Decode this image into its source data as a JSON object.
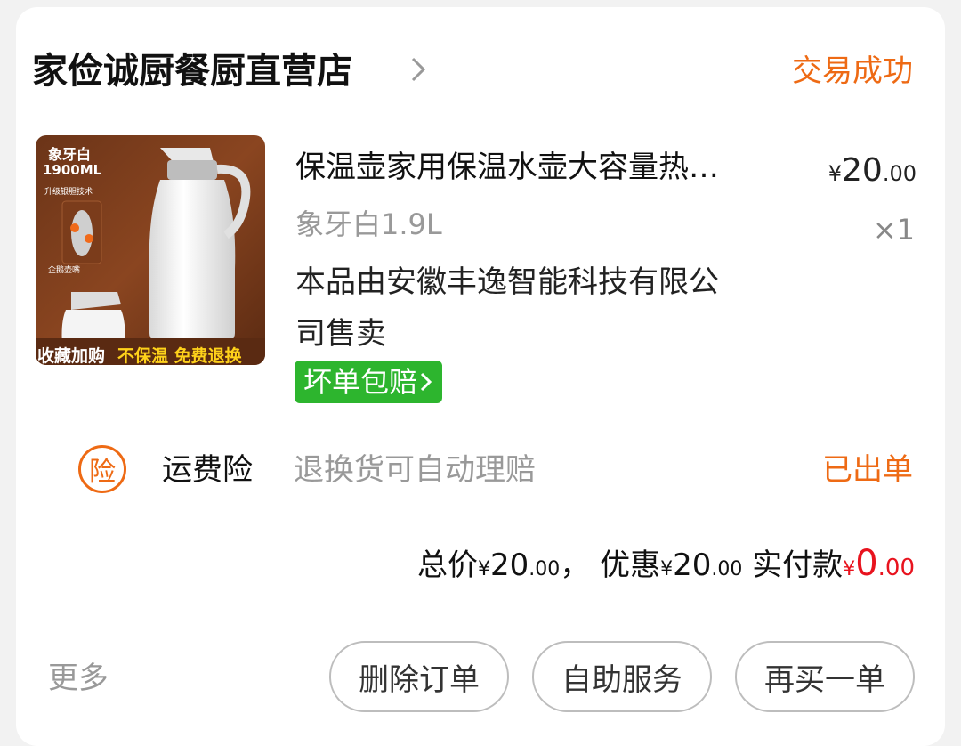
{
  "shop": {
    "name": "家俭诚厨餐厨直营店",
    "status": "交易成功"
  },
  "product": {
    "image_badges": {
      "top_label": "象牙白",
      "capacity": "1900ML",
      "tech": "升级银胆技术",
      "liner": "企鹅壶嘴",
      "bottom_1": "收藏加购",
      "bottom_2": "不保温 免费退换"
    },
    "title": "保温壶家用保温水壶大容量热…",
    "price_symbol": "¥",
    "price_int": "20",
    "price_dec": ".00",
    "variant": "象牙白1.9L",
    "quantity": "×1",
    "seller_note_line1": "本品由安徽丰逸智能科技有限公",
    "seller_note_line2": "司售卖",
    "guarantee_badge": "坏单包赔"
  },
  "insurance": {
    "icon_text": "险",
    "name": "运费险",
    "desc": "退换货可自动理赔",
    "status": "已出单"
  },
  "totals": {
    "total_label": "总价",
    "total_int": "20",
    "total_dec": ".00",
    "separator": "，",
    "discount_label": "优惠",
    "discount_int": "20",
    "discount_dec": ".00",
    "paid_label": "实付款",
    "paid_int": "0",
    "paid_dec": ".00",
    "yen": "¥"
  },
  "actions": {
    "more": "更多",
    "delete": "删除订单",
    "self_service": "自助服务",
    "rebuy": "再买一单"
  },
  "colors": {
    "accent": "#ee6a14",
    "price_red": "#e8131e",
    "badge_green": "#2db52e"
  }
}
